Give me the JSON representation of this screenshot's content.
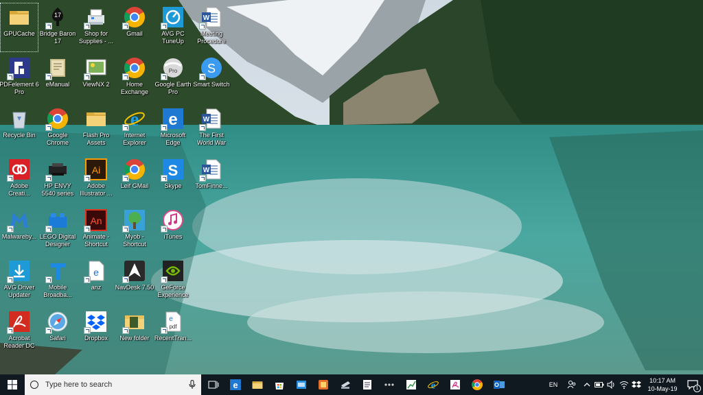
{
  "desktop": {
    "columns": [
      [
        {
          "name": "icon-gpucache",
          "label": "GPUCache",
          "icon": "folder-icon",
          "selected": true
        },
        {
          "name": "icon-pdfelement",
          "label": "PDFelement 6 Pro",
          "icon": "pdfelement-icon"
        },
        {
          "name": "icon-recycle-bin",
          "label": "Recycle Bin",
          "icon": "recycle-bin-icon"
        },
        {
          "name": "icon-adobe-creative",
          "label": "Adobe Creati...",
          "icon": "adobe-cc-icon"
        },
        {
          "name": "icon-malwarebytes",
          "label": "Malwareby...",
          "icon": "malwarebytes-icon"
        },
        {
          "name": "icon-avg-driver",
          "label": "AVG Driver Updater",
          "icon": "avg-driver-icon"
        },
        {
          "name": "icon-acrobat",
          "label": "Acrobat Reader DC",
          "icon": "acrobat-icon"
        }
      ],
      [
        {
          "name": "icon-bridge-baron",
          "label": "Bridge Baron 17",
          "icon": "bridge-baron-icon"
        },
        {
          "name": "icon-emanual",
          "label": "eManual",
          "icon": "emanual-icon"
        },
        {
          "name": "icon-google-chrome",
          "label": "Google Chrome",
          "icon": "chrome-icon"
        },
        {
          "name": "icon-hp-envy",
          "label": "HP ENVY 5540 series",
          "icon": "printer-icon"
        },
        {
          "name": "icon-lego",
          "label": "LEGO Digital Designer",
          "icon": "lego-icon"
        },
        {
          "name": "icon-mobile-broadband",
          "label": "Mobile Broadba...",
          "icon": "telstra-icon"
        },
        {
          "name": "icon-safari",
          "label": "Safari",
          "icon": "safari-icon"
        }
      ],
      [
        {
          "name": "icon-shop-supplies",
          "label": "Shop for Supplies - ...",
          "icon": "shop-printer-icon"
        },
        {
          "name": "icon-viewnx",
          "label": "ViewNX 2",
          "icon": "viewnx-icon"
        },
        {
          "name": "icon-flash-pro",
          "label": "Flash Pro Assets",
          "icon": "folder-icon"
        },
        {
          "name": "icon-illustrator",
          "label": "Adobe Illustrator ...",
          "icon": "illustrator-icon"
        },
        {
          "name": "icon-animate",
          "label": "Animate - Shortcut",
          "icon": "animate-icon"
        },
        {
          "name": "icon-anz",
          "label": "anz",
          "icon": "edge-doc-icon"
        },
        {
          "name": "icon-dropbox",
          "label": "Dropbox",
          "icon": "dropbox-icon"
        }
      ],
      [
        {
          "name": "icon-gmail",
          "label": "Gmail",
          "icon": "chrome-icon"
        },
        {
          "name": "icon-home-exchange",
          "label": "Home Exchange",
          "icon": "chrome-icon"
        },
        {
          "name": "icon-internet-explorer",
          "label": "Internet Explorer",
          "icon": "ie-icon"
        },
        {
          "name": "icon-leif-gmail",
          "label": "Leif GMail",
          "icon": "chrome-icon"
        },
        {
          "name": "icon-myob",
          "label": "Myob - Shortcut",
          "icon": "myob-icon"
        },
        {
          "name": "icon-navdesk",
          "label": "NavDesk 7.50",
          "icon": "navdesk-icon"
        },
        {
          "name": "icon-new-folder",
          "label": "New folder",
          "icon": "new-folder-icon"
        }
      ],
      [
        {
          "name": "icon-avg-tuneup",
          "label": "AVG PC TuneUp",
          "icon": "avg-tuneup-icon"
        },
        {
          "name": "icon-google-earth",
          "label": "Google Earth Pro",
          "icon": "google-earth-icon"
        },
        {
          "name": "icon-microsoft-edge",
          "label": "Microsoft Edge",
          "icon": "edge-icon"
        },
        {
          "name": "icon-skype",
          "label": "Skype",
          "icon": "skype-icon"
        },
        {
          "name": "icon-itunes",
          "label": "iTunes",
          "icon": "itunes-icon"
        },
        {
          "name": "icon-geforce",
          "label": "GeForce Experience",
          "icon": "geforce-icon"
        },
        {
          "name": "icon-recent-tran",
          "label": "RecentTran...",
          "icon": "pdf-doc-icon"
        }
      ],
      [
        {
          "name": "icon-meeting-procedure",
          "label": "Meeting Procedure",
          "icon": "word-doc-icon"
        },
        {
          "name": "icon-smart-switch",
          "label": "Smart Switch",
          "icon": "smart-switch-icon"
        },
        {
          "name": "icon-first-world-war",
          "label": "The First World War",
          "icon": "word-doc-icon"
        },
        {
          "name": "icon-tomfinne",
          "label": "TomFinne...",
          "icon": "word-doc-icon"
        }
      ]
    ]
  },
  "taskbar": {
    "search_placeholder": "Type here to search",
    "pinned": [
      {
        "name": "taskbar-task-view",
        "icon": "task-view-icon"
      },
      {
        "name": "taskbar-edge",
        "icon": "edge-icon"
      },
      {
        "name": "taskbar-file-explorer",
        "icon": "folder-icon"
      },
      {
        "name": "taskbar-store",
        "icon": "store-icon"
      },
      {
        "name": "taskbar-app-blue",
        "icon": "blue-window-icon"
      },
      {
        "name": "taskbar-app-orange",
        "icon": "orange-app-icon"
      },
      {
        "name": "taskbar-scanner",
        "icon": "scanner-icon"
      },
      {
        "name": "taskbar-notepad",
        "icon": "notepad-icon"
      },
      {
        "name": "taskbar-dots",
        "icon": "dots-icon"
      },
      {
        "name": "taskbar-chart-app",
        "icon": "chart-app-icon"
      },
      {
        "name": "taskbar-ie",
        "icon": "ie-icon"
      },
      {
        "name": "taskbar-pdf-app",
        "icon": "pdf-app-icon"
      },
      {
        "name": "taskbar-chrome",
        "icon": "chrome-icon"
      },
      {
        "name": "taskbar-outlook",
        "icon": "outlook-icon"
      }
    ],
    "tray": {
      "language": "EN",
      "time": "10:17 AM",
      "date": "10-May-19",
      "notification_count": "1"
    }
  },
  "colors": {
    "taskbar_bg": "#101820",
    "search_bg": "#f2f2f2",
    "label_text": "#ffffff"
  }
}
